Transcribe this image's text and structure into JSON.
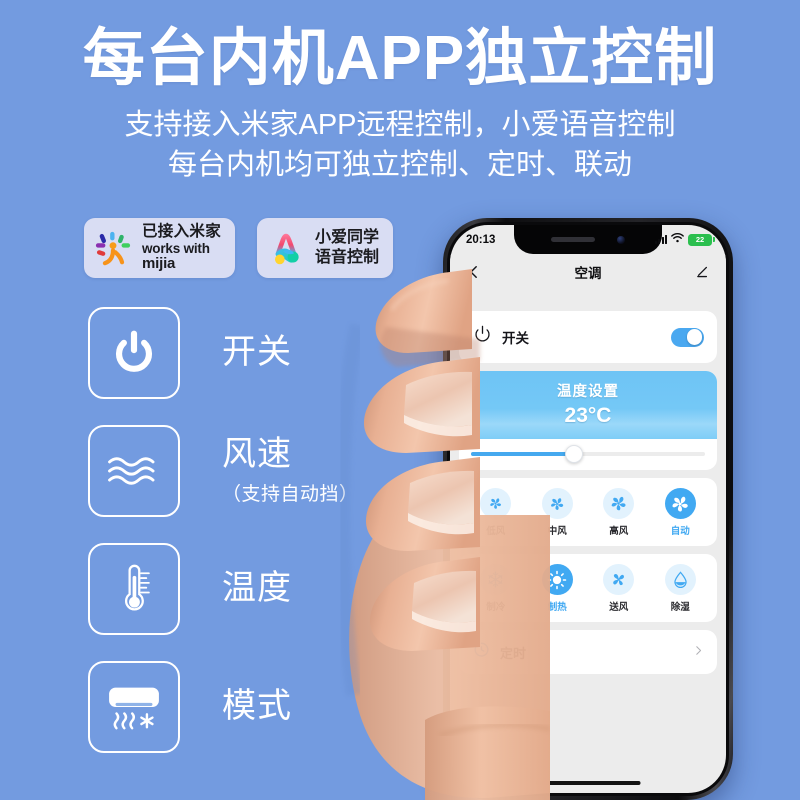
{
  "hero": {
    "title": "每台内机APP独立控制",
    "sub_line1": "支持接入米家APP远程控制，小爱语音控制",
    "sub_line2": "每台内机均可独立控制、定时、联动"
  },
  "badges": [
    {
      "id": "mijia",
      "logo": "mijia-logo-icon",
      "cn": "已接入米家",
      "en1": "works with",
      "en2": "mijia"
    },
    {
      "id": "xiaoai",
      "logo": "xiaoai-logo-icon",
      "line1": "小爱同学",
      "line2": "语音控制"
    }
  ],
  "features": [
    {
      "icon": "power-icon",
      "label": "开关",
      "note": ""
    },
    {
      "icon": "wind-waves-icon",
      "label": "风速",
      "note": "（支持自动挡）"
    },
    {
      "icon": "thermometer-icon",
      "label": "温度",
      "note": ""
    },
    {
      "icon": "ac-unit-icon",
      "label": "模式",
      "note": ""
    }
  ],
  "phone": {
    "status": {
      "time": "20:13",
      "signal": "signal-bars-icon",
      "wifi": "wifi-icon",
      "battery_level": "22"
    },
    "nav": {
      "back": "chevron-left-icon",
      "title": "空调",
      "action": "edit-pencil-icon"
    },
    "power_card": {
      "icon": "power-icon",
      "label": "开关",
      "toggle_state": "on"
    },
    "temperature_card": {
      "title": "温度设置",
      "value": "23°C",
      "slider_percent": 44
    },
    "fan_speeds": [
      {
        "label": "低风",
        "icon": "fan-low-icon",
        "selected": false
      },
      {
        "label": "中风",
        "icon": "fan-mid-icon",
        "selected": false
      },
      {
        "label": "高风",
        "icon": "fan-high-icon",
        "selected": false
      },
      {
        "label": "自动",
        "icon": "fan-auto-icon",
        "selected": true
      }
    ],
    "modes": [
      {
        "label": "制冷",
        "icon": "snowflake-icon",
        "selected": false
      },
      {
        "label": "制热",
        "icon": "sun-icon",
        "selected": true
      },
      {
        "label": "送风",
        "icon": "fan-blade-icon",
        "selected": false
      },
      {
        "label": "除湿",
        "icon": "water-drop-icon",
        "selected": false
      }
    ],
    "timer_row": {
      "icon": "timer-clock-icon",
      "label": "定时",
      "chevron": "chevron-right-icon"
    }
  },
  "colors": {
    "background": "#739BE0",
    "accent_blue": "#41A9F2",
    "card_white": "#FFFFFF",
    "screen_gray": "#ECECEC",
    "badge_bg": "#D9DDF3",
    "battery_green": "#2BBF4E"
  }
}
